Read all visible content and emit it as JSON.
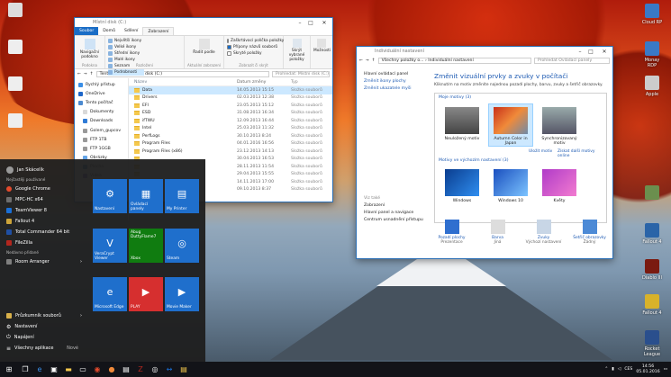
{
  "desktop": {
    "left_icons": [
      "",
      "",
      "",
      ""
    ],
    "right_icons": [
      "Cloud RP",
      "Monay RDP",
      "Apple",
      "",
      "Fallout 4",
      "Diablo III",
      "Fallout 4",
      "Rocket League"
    ]
  },
  "explorer": {
    "title": "Místní disk (C:)",
    "tabs": [
      "Soubor",
      "Domů",
      "Sdílení",
      "Zobrazení"
    ],
    "ribbon": {
      "panes": [
        "Navigační podokno"
      ],
      "layout": [
        "Největší ikony",
        "Velké ikony",
        "Střední ikony",
        "Malé ikony",
        "Seznam",
        "Podrobnosti"
      ],
      "sort_label": "Řadit podle",
      "checkboxes": [
        "Zaškrtávací políčka položky",
        "Přípony názvů souborů",
        "Skryté položky"
      ],
      "hide_label": "Skrýt vybrané položky",
      "options_label": "Možnosti",
      "group_labels": [
        "Podokna",
        "Rozložení",
        "Aktuální zobrazení",
        "Zobrazit či skrýt"
      ]
    },
    "breadcrumb": [
      "Tento počítač",
      "Místní disk (C:)"
    ],
    "search_placeholder": "Prohledat: Místní disk (C:)",
    "nav": [
      "Rychlý přístup",
      "OneDrive",
      "Tento počítač",
      "Dokumenty",
      "Downloads",
      "Golem_gupcov",
      "FTP 1TB",
      "FTP 1GGB",
      "Obrázky",
      "Plocha",
      "Videa"
    ],
    "columns": [
      "Název",
      "Datum změny",
      "Typ"
    ],
    "rows": [
      {
        "name": "Data",
        "date": "14.05.2013 15:15",
        "type": "Složka souborů"
      },
      {
        "name": "Drivers",
        "date": "02.03.2013 12:38",
        "type": "Složka souborů"
      },
      {
        "name": "EFI",
        "date": "23.05.2013 15:12",
        "type": "Složka souborů"
      },
      {
        "name": "ESD",
        "date": "31.08.2013 16:34",
        "type": "Složka souborů"
      },
      {
        "name": "ifTWU",
        "date": "12.09.2013 16:44",
        "type": "Složka souborů"
      },
      {
        "name": "Intel",
        "date": "25.03.2013 11:32",
        "type": "Složka souborů"
      },
      {
        "name": "PerfLogs",
        "date": "30.10.2013 8:24",
        "type": "Složka souborů"
      },
      {
        "name": "Program Files",
        "date": "04.01.2016 16:56",
        "type": "Složka souborů"
      },
      {
        "name": "Program Files (x86)",
        "date": "23.12.2013 14:13",
        "type": "Složka souborů"
      },
      {
        "name": "",
        "date": "30.04.2013 16:53",
        "type": "Složka souborů"
      },
      {
        "name": "",
        "date": "28.11.2013 11:54",
        "type": "Složka souborů"
      },
      {
        "name": "",
        "date": "29.04.2013 15:55",
        "type": "Složka souborů"
      },
      {
        "name": "",
        "date": "14.11.2013 17:00",
        "type": "Složka souborů"
      },
      {
        "name": "",
        "date": "09.10.2013 8:37",
        "type": "Složka souborů"
      }
    ]
  },
  "control_panel": {
    "title": "Individuální nastavení",
    "breadcrumb": [
      "Všechny položky o...",
      "Individuální nastavení"
    ],
    "search_placeholder": "Prohledat Ovládací panely",
    "left_links": [
      "Hlavní ovládací panel",
      "Změnit ikony plochy",
      "Změnit ukazatele myši"
    ],
    "see_also_head": "Viz také",
    "see_also": [
      "Zobrazení",
      "Hlavní panel a navigace",
      "Centrum usnadnění přístupu"
    ],
    "heading": "Změnit vizuální prvky a zvuky v počítači",
    "subheading": "Kliknutím na motiv změníte najednou pozadí plochy, barvu, zvuky a šetřič obrazovky.",
    "my_themes": "Moje motivy (3)",
    "themes_mine": [
      "Neuložený motiv",
      "Autumn Color in Japan",
      "Synchronizovaný motiv"
    ],
    "save_theme": "Uložit motiv",
    "online_themes": "Získat další motivy online",
    "default_themes": "Motivy ve výchozím nastavení (3)",
    "themes_default": [
      "Windows",
      "Windows 10",
      "Květy"
    ],
    "bottom": [
      {
        "label": "Pozadí plochy",
        "sub": "Prezentace"
      },
      {
        "label": "Barva",
        "sub": "Jiná"
      },
      {
        "label": "Zvuky",
        "sub": "Výchozí nastavení"
      },
      {
        "label": "Šetřič obrazovky",
        "sub": "Žádný"
      }
    ]
  },
  "start_menu": {
    "user": "Jan Skácelík",
    "most_used_head": "Nejčastěji používané",
    "most_used": [
      "Google Chrome",
      "MPC-HC x64",
      "TeamViewer 8",
      "Fallout 4",
      "Total Commander 64 bit",
      "FileZilla"
    ],
    "recent_head": "Nedávno přidané",
    "recent": [
      "Room Arranger"
    ],
    "bottom": [
      "Průzkumník souborů",
      "Nastavení",
      "Napájení",
      "Všechny aplikace"
    ],
    "new_badge": "Nové",
    "tiles": [
      {
        "label": "Nastavení",
        "color": "#1f6fcc",
        "glyph": "⚙"
      },
      {
        "label": "Ovládací panely",
        "color": "#1f6fcc",
        "glyph": "▦"
      },
      {
        "label": "My Printer",
        "color": "#1f6fcc",
        "glyph": "▤"
      },
      {
        "label": "VeraCrypt Viewer",
        "color": "#1f6fcc",
        "glyph": "V"
      },
      {
        "label": "Xbox",
        "color": "#107c10",
        "glyph": "Abug DuttyFlame7"
      },
      {
        "label": "Steam",
        "color": "#1f6fcc",
        "glyph": "◎"
      },
      {
        "label": "Microsoft Edge",
        "color": "#1f6fcc",
        "glyph": "e"
      },
      {
        "label": "PLAY",
        "color": "#d62f2f",
        "glyph": "▶"
      },
      {
        "label": "Movie Maker",
        "color": "#1f6fcc",
        "glyph": "▶"
      }
    ]
  },
  "taskbar": {
    "time": "14:56",
    "date": "05.01.2016",
    "lang": "CES"
  }
}
